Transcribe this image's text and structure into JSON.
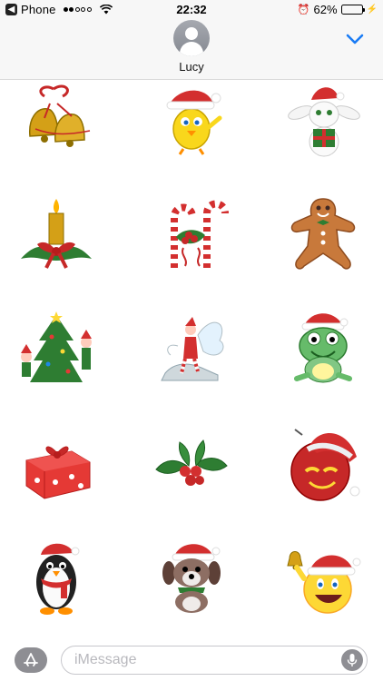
{
  "status_bar": {
    "back_app": "Phone",
    "time": "22:32",
    "battery_percent": "62%",
    "battery_level": 0.62,
    "signal_bars_filled": 2,
    "signal_bars_total": 5,
    "icons": [
      "back-arrow-icon",
      "signal-icon",
      "wifi-icon",
      "alarm-icon",
      "battery-icon",
      "charging-bolt-icon"
    ]
  },
  "header": {
    "contact_name": "Lucy",
    "avatar_icon": "person-silhouette-icon",
    "expand_icon": "chevron-down-icon",
    "accent_color": "#1a7cf5"
  },
  "stickers": [
    {
      "name": "christmas-bells"
    },
    {
      "name": "chick-santa-hat"
    },
    {
      "name": "bunny-with-gift"
    },
    {
      "name": "christmas-candle"
    },
    {
      "name": "candy-canes"
    },
    {
      "name": "gingerbread-man"
    },
    {
      "name": "elves-decorating-tree"
    },
    {
      "name": "christmas-fairy"
    },
    {
      "name": "frog-santa-hat"
    },
    {
      "name": "gift-box"
    },
    {
      "name": "holly-berries"
    },
    {
      "name": "ornament-santa-hat"
    },
    {
      "name": "penguin-santa-hat"
    },
    {
      "name": "puppy-santa-hat"
    },
    {
      "name": "smiley-santa-bell"
    }
  ],
  "composer": {
    "placeholder": "iMessage",
    "left_icon": "app-store-icon",
    "right_icon": "microphone-icon"
  }
}
